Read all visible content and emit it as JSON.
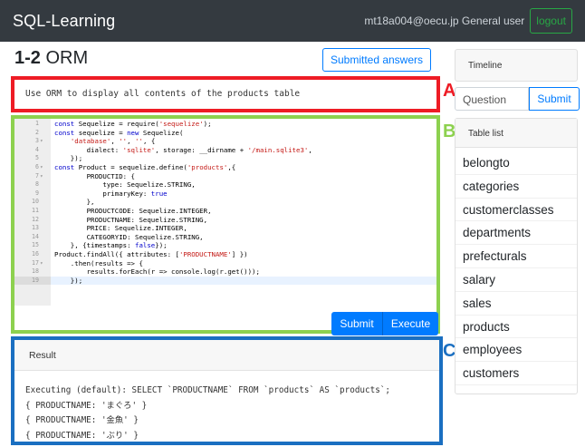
{
  "navbar": {
    "brand": "SQL-Learning",
    "user": "mt18a004@oecu.jp General user",
    "logout": "logout"
  },
  "page": {
    "number": "1-2",
    "title": "ORM",
    "submitted_answers": "Submitted answers"
  },
  "question": {
    "text": "Use ORM to display all contents of the products table"
  },
  "editor": {
    "lines": [
      {
        "n": "1",
        "fold": "",
        "code": [
          {
            "t": "const",
            "c": "kw"
          },
          {
            "t": " Sequelize = require(",
            "c": ""
          },
          {
            "t": "'sequelize'",
            "c": "str"
          },
          {
            "t": ");",
            "c": ""
          }
        ]
      },
      {
        "n": "2",
        "fold": "",
        "code": [
          {
            "t": "const",
            "c": "kw"
          },
          {
            "t": " sequelize = ",
            "c": ""
          },
          {
            "t": "new",
            "c": "kw"
          },
          {
            "t": " Sequelize(",
            "c": ""
          }
        ]
      },
      {
        "n": "3",
        "fold": "▾",
        "code": [
          {
            "t": "    ",
            "c": ""
          },
          {
            "t": "'database'",
            "c": "str"
          },
          {
            "t": ", ",
            "c": ""
          },
          {
            "t": "''",
            "c": "str"
          },
          {
            "t": ", ",
            "c": ""
          },
          {
            "t": "''",
            "c": "str"
          },
          {
            "t": ", {",
            "c": ""
          }
        ]
      },
      {
        "n": "4",
        "fold": "",
        "code": [
          {
            "t": "        dialect: ",
            "c": ""
          },
          {
            "t": "'sqlite'",
            "c": "str"
          },
          {
            "t": ", storage: __dirname + ",
            "c": ""
          },
          {
            "t": "'/main.sqlite3'",
            "c": "str"
          },
          {
            "t": ",",
            "c": ""
          }
        ]
      },
      {
        "n": "5",
        "fold": "",
        "code": [
          {
            "t": "    });",
            "c": ""
          }
        ]
      },
      {
        "n": "6",
        "fold": "▾",
        "code": [
          {
            "t": "const",
            "c": "kw"
          },
          {
            "t": " Product = sequelize.define(",
            "c": ""
          },
          {
            "t": "'products'",
            "c": "str"
          },
          {
            "t": ",{",
            "c": ""
          }
        ]
      },
      {
        "n": "7",
        "fold": "▾",
        "code": [
          {
            "t": "        PRODUCTID: {",
            "c": ""
          }
        ]
      },
      {
        "n": "8",
        "fold": "",
        "code": [
          {
            "t": "            type: Sequelize.STRING,",
            "c": ""
          }
        ]
      },
      {
        "n": "9",
        "fold": "",
        "code": [
          {
            "t": "            primaryKey: ",
            "c": ""
          },
          {
            "t": "true",
            "c": "kw"
          }
        ]
      },
      {
        "n": "10",
        "fold": "",
        "code": [
          {
            "t": "        },",
            "c": ""
          }
        ]
      },
      {
        "n": "11",
        "fold": "",
        "code": [
          {
            "t": "        PRODUCTCODE: Sequelize.INTEGER,",
            "c": ""
          }
        ]
      },
      {
        "n": "12",
        "fold": "",
        "code": [
          {
            "t": "        PRODUCTNAME: Sequelize.STRING,",
            "c": ""
          }
        ]
      },
      {
        "n": "13",
        "fold": "",
        "code": [
          {
            "t": "        PRICE: Sequelize.INTEGER,",
            "c": ""
          }
        ]
      },
      {
        "n": "14",
        "fold": "",
        "code": [
          {
            "t": "        CATEGORYID: Sequelize.STRING,",
            "c": ""
          }
        ]
      },
      {
        "n": "15",
        "fold": "",
        "code": [
          {
            "t": "    }, {timestamps: ",
            "c": ""
          },
          {
            "t": "false",
            "c": "kw"
          },
          {
            "t": "});",
            "c": ""
          }
        ]
      },
      {
        "n": "16",
        "fold": "",
        "code": [
          {
            "t": "Product.findAll({ attributes: [",
            "c": ""
          },
          {
            "t": "'PRODUCTNAME'",
            "c": "str"
          },
          {
            "t": "] })",
            "c": ""
          }
        ]
      },
      {
        "n": "17",
        "fold": "▾",
        "code": [
          {
            "t": "    .then(results => {",
            "c": ""
          }
        ]
      },
      {
        "n": "18",
        "fold": "",
        "code": [
          {
            "t": "        results.forEach(r => console.log(r.get()));",
            "c": ""
          }
        ]
      },
      {
        "n": "19",
        "fold": "",
        "code": [
          {
            "t": "    });",
            "c": ""
          }
        ],
        "active": true
      }
    ],
    "submit": "Submit",
    "execute": "Execute"
  },
  "result": {
    "title": "Result",
    "lines": [
      "Executing (default): SELECT `PRODUCTNAME` FROM `products` AS `products`;",
      "{ PRODUCTNAME: 'まぐろ' }",
      "{ PRODUCTNAME: '金魚' }",
      "{ PRODUCTNAME: 'ぶり' }"
    ]
  },
  "labels": {
    "a": "A",
    "b": "B",
    "c": "C"
  },
  "sidebar": {
    "timeline": "Timeline",
    "question_placeholder": "Question",
    "submit": "Submit",
    "table_list_title": "Table list",
    "tables": [
      "belongto",
      "categories",
      "customerclasses",
      "departments",
      "prefecturals",
      "salary",
      "sales",
      "products",
      "employees",
      "customers"
    ]
  },
  "colors": {
    "box_a": "#ee1c25",
    "box_b": "#8dd14f",
    "box_c": "#1a6fc1",
    "primary": "#007bff",
    "navbar": "#343a40",
    "logout": "#28a745"
  }
}
